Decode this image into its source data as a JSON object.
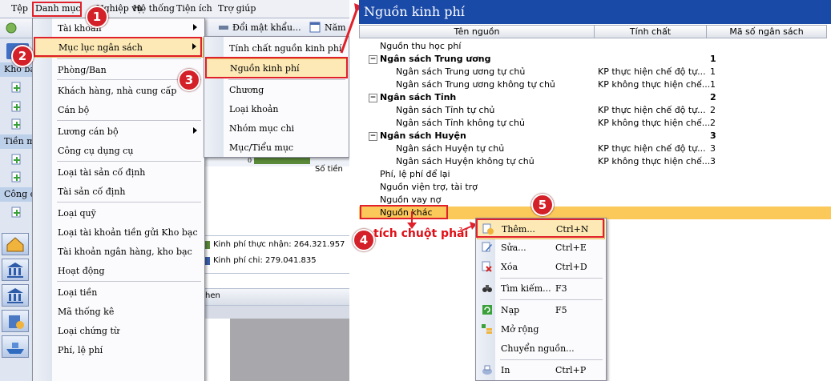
{
  "menubar": {
    "items": [
      "Tệp",
      "Danh mục",
      "Nghiệp vụ",
      "Hệ thống",
      "Tiện ích",
      "Trợ giúp"
    ]
  },
  "toolbar": {
    "items": [
      "Đổi mật khẩu...",
      "Năm"
    ]
  },
  "leftnav": {
    "headers": [
      "Kho bạ",
      "Tiền m",
      "Công c"
    ]
  },
  "background_content": {
    "chart_xlabel": "Số tiền",
    "chart_zero": "0",
    "legend": [
      "Kinh phí thực nhận: 264.321.957",
      "Kinh phí chi: 279.041.835"
    ],
    "tab_fragment": "hen"
  },
  "menu_danhmuc": {
    "items": [
      "Tài khoản",
      "Mục lục ngân sách",
      "Phòng/Ban",
      "Khách hàng, nhà cung cấp",
      "Cán bộ",
      "Lương cán bộ",
      "Công cụ dụng cụ",
      "Loại tài sản cố định",
      "Tài sản cố định",
      "Loại quỹ",
      "Loại tài khoản tiền gửi Kho bạc",
      "Tài khoản ngân hàng, kho bạc",
      "Hoạt động",
      "Loại tiền",
      "Mã thống kê",
      "Loại chứng từ",
      "Phí, lệ phí"
    ]
  },
  "submenu_mlns": {
    "items": [
      "Tính chất nguồn kinh phí",
      "Nguồn kinh phí",
      "Chương",
      "Loại khoản",
      "Nhóm mục chi",
      "Mục/Tiểu mục"
    ]
  },
  "steps": [
    "1",
    "2",
    "3",
    "4",
    "5"
  ],
  "annotation": "tích chuột phải",
  "panel": {
    "title": "Nguồn kinh phí",
    "columns": [
      "Tên nguồn",
      "Tính chất",
      "Mã số ngân sách"
    ],
    "rows": [
      {
        "name": "Nguồn thu học phí",
        "tinh_chat": "",
        "ma": ""
      },
      {
        "name": "Ngân sách Trung ương",
        "tinh_chat": "",
        "ma": "1"
      },
      {
        "name": "Ngân sách Trung ương tự chủ",
        "tinh_chat": "KP thực hiện chế độ tự...",
        "ma": "1"
      },
      {
        "name": "Ngân sách Trung ương không tự chủ",
        "tinh_chat": "KP không thực hiện chế...",
        "ma": "1"
      },
      {
        "name": "Ngân sách Tỉnh",
        "tinh_chat": "",
        "ma": "2"
      },
      {
        "name": "Ngân sách Tỉnh tự chủ",
        "tinh_chat": "KP thực hiện chế độ tự...",
        "ma": "2"
      },
      {
        "name": "Ngân sách Tỉnh không tự chủ",
        "tinh_chat": "KP không thực hiện chế...",
        "ma": "2"
      },
      {
        "name": "Ngân sách Huyện",
        "tinh_chat": "",
        "ma": "3"
      },
      {
        "name": "Ngân sách Huyện tự chủ",
        "tinh_chat": "KP thực hiện chế độ tự...",
        "ma": "3"
      },
      {
        "name": "Ngân sách Huyện không tự chủ",
        "tinh_chat": "KP không thực hiện chế...",
        "ma": "3"
      },
      {
        "name": "Phí, lệ phí để lại",
        "tinh_chat": "",
        "ma": ""
      },
      {
        "name": "Nguồn viện trợ, tài trợ",
        "tinh_chat": "",
        "ma": ""
      },
      {
        "name": "Nguồn vay nợ",
        "tinh_chat": "",
        "ma": ""
      },
      {
        "name": "Nguồn khác",
        "tinh_chat": "",
        "ma": ""
      }
    ]
  },
  "context_menu": {
    "items": [
      {
        "label": "Thêm...",
        "shortcut": "Ctrl+N"
      },
      {
        "label": "Sửa...",
        "shortcut": "Ctrl+E"
      },
      {
        "label": "Xóa",
        "shortcut": "Ctrl+D"
      },
      {
        "label": "Tìm kiếm...",
        "shortcut": "F3"
      },
      {
        "label": "Nạp",
        "shortcut": "F5"
      },
      {
        "label": "Mở rộng",
        "shortcut": ""
      },
      {
        "label": "Chuyển nguồn...",
        "shortcut": ""
      },
      {
        "label": "In",
        "shortcut": "Ctrl+P"
      }
    ]
  },
  "colors": {
    "title_bar": "#1a4aa8",
    "highlight_row": "#fbc85a",
    "accent_red": "#e0202a"
  }
}
